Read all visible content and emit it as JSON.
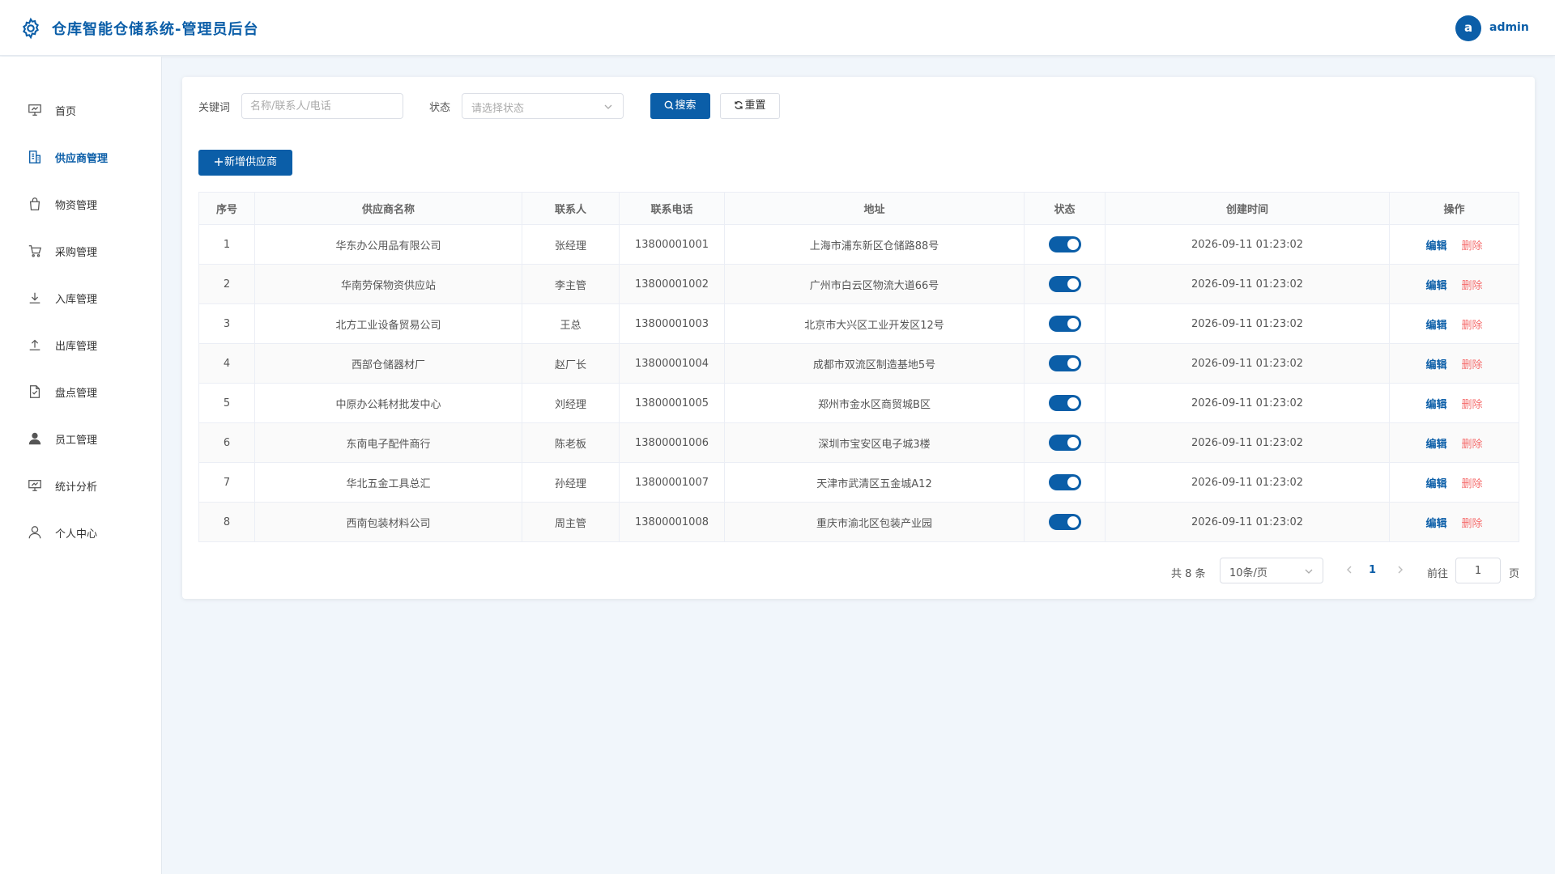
{
  "header": {
    "title": "仓库智能仓储系统-管理员后台",
    "avatar_letter": "a",
    "username": "admin"
  },
  "sidebar": {
    "items": [
      {
        "label": "首页",
        "icon": "dashboard-icon",
        "active": false
      },
      {
        "label": "供应商管理",
        "icon": "building-icon",
        "active": true
      },
      {
        "label": "物资管理",
        "icon": "bag-icon",
        "active": false
      },
      {
        "label": "采购管理",
        "icon": "cart-icon",
        "active": false
      },
      {
        "label": "入库管理",
        "icon": "download-icon",
        "active": false
      },
      {
        "label": "出库管理",
        "icon": "upload-icon",
        "active": false
      },
      {
        "label": "盘点管理",
        "icon": "document-check-icon",
        "active": false
      },
      {
        "label": "员工管理",
        "icon": "user-filled-icon",
        "active": false
      },
      {
        "label": "统计分析",
        "icon": "chart-board-icon",
        "active": false
      },
      {
        "label": "个人中心",
        "icon": "user-icon",
        "active": false
      }
    ]
  },
  "filters": {
    "keyword_label": "关键词",
    "keyword_placeholder": "名称/联系人/电话",
    "keyword_value": "",
    "status_label": "状态",
    "status_placeholder": "请选择状态",
    "search_label": "搜索",
    "reset_label": "重置"
  },
  "toolbar": {
    "add_label": "新增供应商"
  },
  "table": {
    "columns": [
      "序号",
      "供应商名称",
      "联系人",
      "联系电话",
      "地址",
      "状态",
      "创建时间",
      "操作"
    ],
    "rows": [
      {
        "index": "1",
        "name": "华东办公用品有限公司",
        "contact": "张经理",
        "phone": "13800001001",
        "address": "上海市浦东新区仓储路88号",
        "enabled": true,
        "created": "2026-09-11 01:23:02"
      },
      {
        "index": "2",
        "name": "华南劳保物资供应站",
        "contact": "李主管",
        "phone": "13800001002",
        "address": "广州市白云区物流大道66号",
        "enabled": true,
        "created": "2026-09-11 01:23:02"
      },
      {
        "index": "3",
        "name": "北方工业设备贸易公司",
        "contact": "王总",
        "phone": "13800001003",
        "address": "北京市大兴区工业开发区12号",
        "enabled": true,
        "created": "2026-09-11 01:23:02"
      },
      {
        "index": "4",
        "name": "西部仓储器材厂",
        "contact": "赵厂长",
        "phone": "13800001004",
        "address": "成都市双流区制造基地5号",
        "enabled": true,
        "created": "2026-09-11 01:23:02"
      },
      {
        "index": "5",
        "name": "中原办公耗材批发中心",
        "contact": "刘经理",
        "phone": "13800001005",
        "address": "郑州市金水区商贸城B区",
        "enabled": true,
        "created": "2026-09-11 01:23:02"
      },
      {
        "index": "6",
        "name": "东南电子配件商行",
        "contact": "陈老板",
        "phone": "13800001006",
        "address": "深圳市宝安区电子城3楼",
        "enabled": true,
        "created": "2026-09-11 01:23:02"
      },
      {
        "index": "7",
        "name": "华北五金工具总汇",
        "contact": "孙经理",
        "phone": "13800001007",
        "address": "天津市武清区五金城A12",
        "enabled": true,
        "created": "2026-09-11 01:23:02"
      },
      {
        "index": "8",
        "name": "西南包装材料公司",
        "contact": "周主管",
        "phone": "13800001008",
        "address": "重庆市渝北区包装产业园",
        "enabled": true,
        "created": "2026-09-11 01:23:02"
      }
    ],
    "edit_label": "编辑",
    "delete_label": "删除"
  },
  "pagination": {
    "total_text": "共 8 条",
    "page_size": "10条/页",
    "current_page": "1",
    "goto_label": "前往",
    "goto_value": "1",
    "page_suffix": "页"
  },
  "colors": {
    "primary": "#0b5ea8",
    "danger": "#f56c6c",
    "background": "#f1f6fb"
  }
}
